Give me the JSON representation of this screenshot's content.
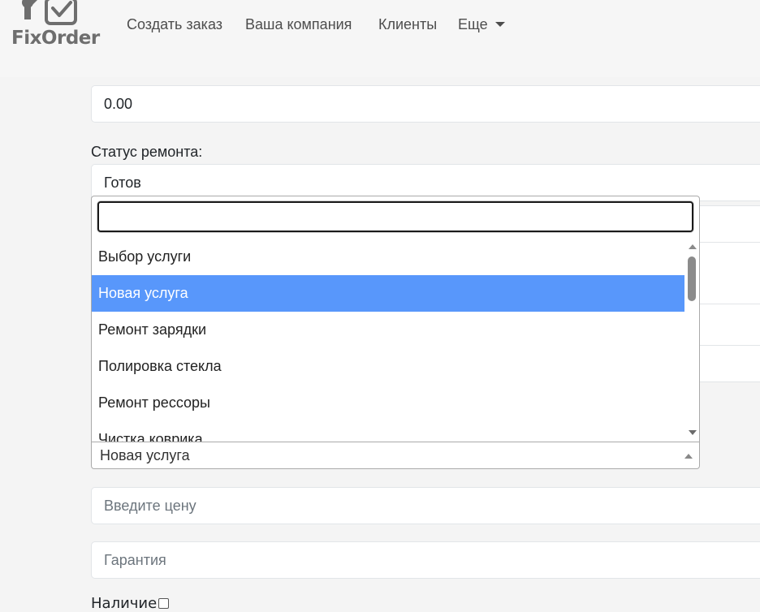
{
  "navbar": {
    "logo_text": "FixOrder",
    "links": [
      "Создать заказ",
      "Ваша компания",
      "Клиенты",
      "Еще"
    ]
  },
  "form": {
    "top_value": "0.00",
    "repair_status_label": "Статус ремонта:",
    "repair_status_value": "Готов",
    "price_placeholder": "Введите цену",
    "warranty_placeholder": "Гарантия",
    "bottom_label": "Наличие"
  },
  "service_select": {
    "search_value": "",
    "options": [
      "Выбор услуги",
      "Новая услуга",
      "Ремонт зарядки",
      "Полировка стекла",
      "Ремонт рессоры",
      "Чистка коврика"
    ],
    "highlighted_index": 1,
    "selected_value": "Новая услуга"
  },
  "colors": {
    "highlight": "#5897fb",
    "background": "#f4f4f4",
    "logo": "#6e6e6e"
  }
}
